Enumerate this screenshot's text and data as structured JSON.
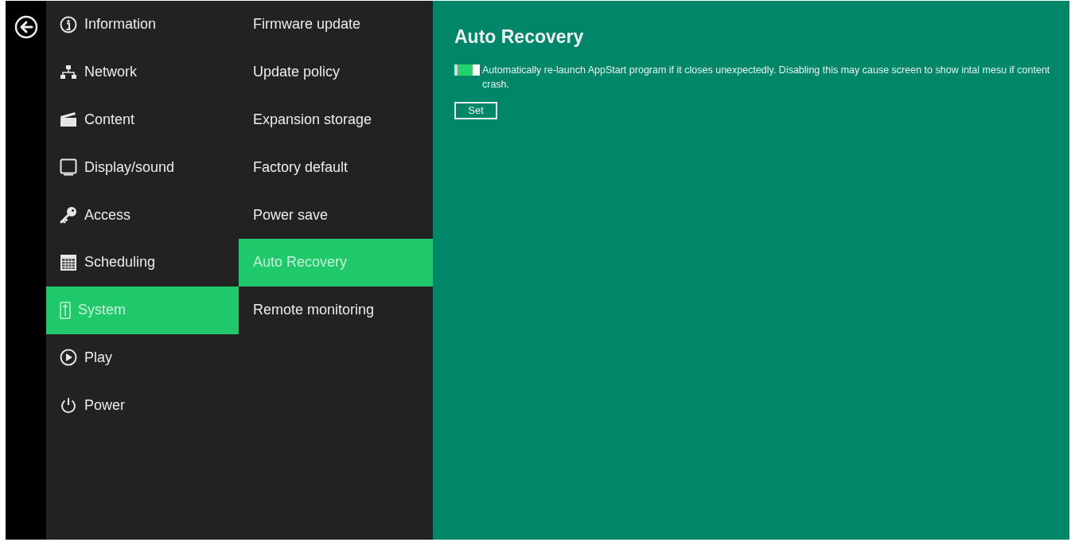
{
  "main_menu": [
    {
      "label": "Information",
      "selected": false
    },
    {
      "label": "Network",
      "selected": false
    },
    {
      "label": "Content",
      "selected": false
    },
    {
      "label": "Display/sound",
      "selected": false
    },
    {
      "label": "Access",
      "selected": false
    },
    {
      "label": "Scheduling",
      "selected": false
    },
    {
      "label": "System",
      "selected": true
    },
    {
      "label": "Play",
      "selected": false
    },
    {
      "label": "Power",
      "selected": false
    }
  ],
  "sub_menu": [
    {
      "label": "Firmware update",
      "selected": false
    },
    {
      "label": "Update policy",
      "selected": false
    },
    {
      "label": "Expansion storage",
      "selected": false
    },
    {
      "label": "Factory default",
      "selected": false
    },
    {
      "label": "Power save",
      "selected": false
    },
    {
      "label": "Auto Recovery",
      "selected": true
    },
    {
      "label": "Remote monitoring",
      "selected": false
    }
  ],
  "content": {
    "title": "Auto Recovery",
    "auto_relaunch": {
      "on": true,
      "description": "Automatically re-launch AppStart program if it closes unexpectedly. Disabling this may cause screen to show intal mesu if content crash."
    },
    "set_button": "Set"
  }
}
